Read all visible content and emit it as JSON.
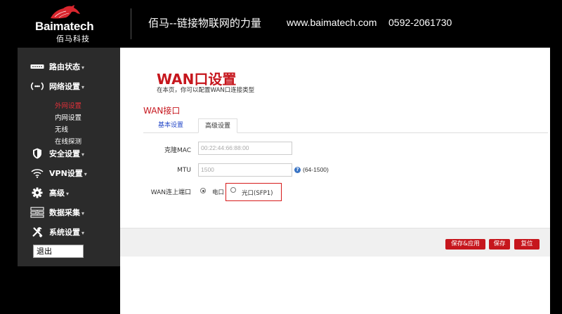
{
  "header": {
    "brand": "Baimatech",
    "brand_cn": "佰马科技",
    "slogan": "佰马--链接物联网的力量",
    "website": "www.baimatech.com",
    "phone": "0592-2061730"
  },
  "sidebar": {
    "items": [
      {
        "label": "路由状态",
        "icon": "router-icon"
      },
      {
        "label": "网络设置",
        "icon": "network-icon"
      },
      {
        "label": "安全设置",
        "icon": "shield-icon"
      },
      {
        "label": "VPN设置",
        "icon": "wifi-icon"
      },
      {
        "label": "高级",
        "icon": "gear-icon"
      },
      {
        "label": "数据采集",
        "icon": "data-icon"
      },
      {
        "label": "系统设置",
        "icon": "tools-icon"
      }
    ],
    "sub_items": [
      "外网设置",
      "内网设置",
      "无线",
      "在线探测"
    ],
    "active_sub": "外网设置",
    "logout": "退出"
  },
  "main": {
    "title": "WAN口设置",
    "description": "在本页，你可以配置WAN口连接类型",
    "section": "WAN接口",
    "tabs": [
      "基本设置",
      "高级设置"
    ],
    "active_tab": "高级设置",
    "fields": {
      "mac_label": "克隆MAC",
      "mac_placeholder": "00:22:44:66:88:00",
      "mtu_label": "MTU",
      "mtu_placeholder": "1500",
      "mtu_range": "(64-1500)",
      "port_label": "WAN连上端口",
      "port_options": [
        "电口",
        "光口(SFP1)"
      ],
      "port_selected": "电口"
    },
    "buttons": {
      "save_apply": "保存&应用",
      "save": "保存",
      "reset": "复位"
    }
  },
  "colors": {
    "accent": "#c6161d",
    "sidebar_bg": "#2b2b2b",
    "active_tab_link": "#2448c8"
  }
}
